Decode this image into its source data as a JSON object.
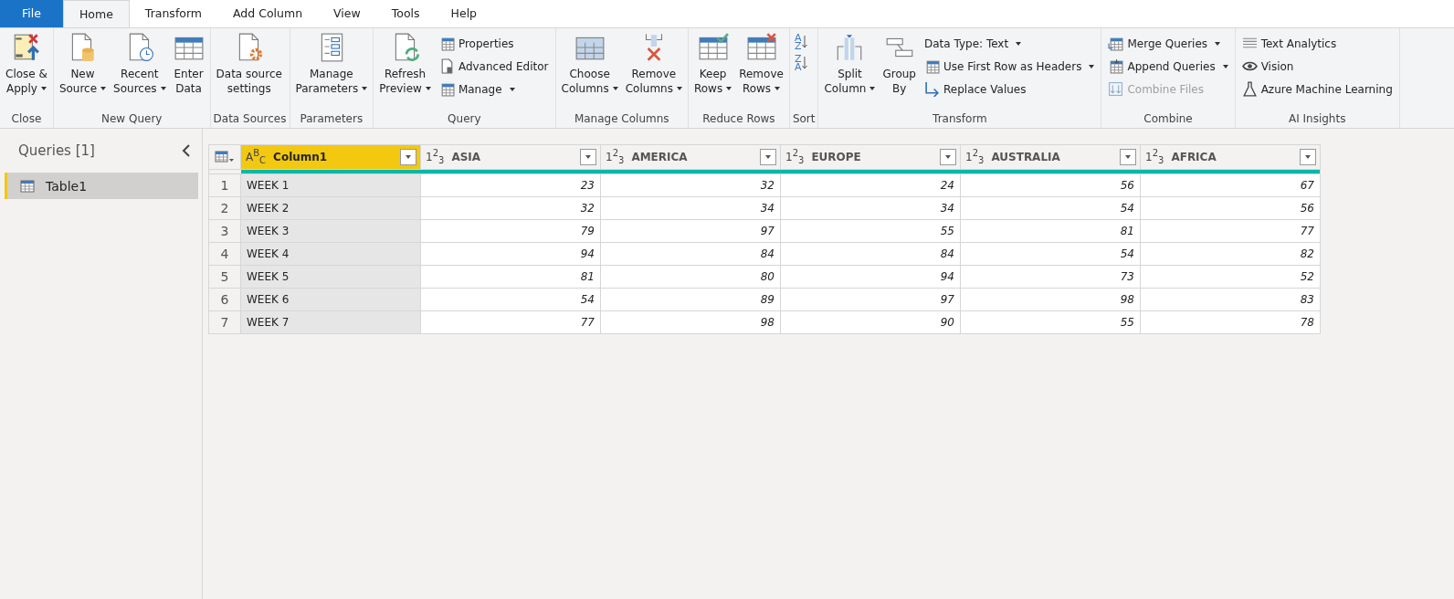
{
  "tabs": [
    {
      "label": "File",
      "kind": "file",
      "selected": false
    },
    {
      "label": "Home",
      "kind": "tab",
      "selected": true
    },
    {
      "label": "Transform",
      "kind": "tab",
      "selected": false
    },
    {
      "label": "Add Column",
      "kind": "tab",
      "selected": false
    },
    {
      "label": "View",
      "kind": "tab",
      "selected": false
    },
    {
      "label": "Tools",
      "kind": "tab",
      "selected": false
    },
    {
      "label": "Help",
      "kind": "tab",
      "selected": false
    }
  ],
  "ribbon": [
    {
      "label": "Close",
      "items": [
        {
          "kind": "large",
          "lines": [
            "Close &",
            "Apply"
          ],
          "dropdown": true
        }
      ]
    },
    {
      "label": "New Query",
      "items": [
        {
          "kind": "large",
          "lines": [
            "New",
            "Source"
          ],
          "dropdown": true
        },
        {
          "kind": "large",
          "lines": [
            "Recent",
            "Sources"
          ],
          "dropdown": true
        },
        {
          "kind": "large",
          "lines": [
            "Enter",
            "Data"
          ],
          "dropdown": false
        }
      ]
    },
    {
      "label": "Data Sources",
      "items": [
        {
          "kind": "large",
          "lines": [
            "Data source",
            "settings"
          ],
          "dropdown": false
        }
      ]
    },
    {
      "label": "Parameters",
      "items": [
        {
          "kind": "large",
          "lines": [
            "Manage",
            "Parameters"
          ],
          "dropdown": true
        }
      ]
    },
    {
      "label": "Query",
      "items": [
        {
          "kind": "large",
          "lines": [
            "Refresh",
            "Preview"
          ],
          "dropdown": true
        },
        {
          "kind": "stack",
          "children": [
            {
              "label": "Properties",
              "dropdown": false,
              "disabled": false
            },
            {
              "label": "Advanced Editor",
              "dropdown": false,
              "disabled": false
            },
            {
              "label": "Manage",
              "dropdown": true,
              "disabled": false
            }
          ]
        }
      ]
    },
    {
      "label": "Manage Columns",
      "items": [
        {
          "kind": "large",
          "lines": [
            "Choose",
            "Columns"
          ],
          "dropdown": true
        },
        {
          "kind": "large",
          "lines": [
            "Remove",
            "Columns"
          ],
          "dropdown": true
        }
      ]
    },
    {
      "label": "Reduce Rows",
      "items": [
        {
          "kind": "large",
          "lines": [
            "Keep",
            "Rows"
          ],
          "dropdown": true
        },
        {
          "kind": "large",
          "lines": [
            "Remove",
            "Rows"
          ],
          "dropdown": true
        }
      ]
    },
    {
      "label": "Sort",
      "items": [
        {
          "kind": "sort",
          "children": [
            {
              "glyph": "AZ"
            },
            {
              "glyph": "ZA"
            }
          ]
        }
      ]
    },
    {
      "label": "Transform",
      "items": [
        {
          "kind": "large",
          "lines": [
            "Split",
            "Column"
          ],
          "dropdown": true
        },
        {
          "kind": "large",
          "lines": [
            "Group",
            "By"
          ],
          "dropdown": false
        },
        {
          "kind": "stack",
          "children": [
            {
              "label": "Data Type: Text",
              "dropdown": true,
              "disabled": false
            },
            {
              "label": "Use First Row as Headers",
              "dropdown": true,
              "disabled": false
            },
            {
              "label": "Replace Values",
              "dropdown": false,
              "disabled": false
            }
          ]
        }
      ]
    },
    {
      "label": "Combine",
      "items": [
        {
          "kind": "stack",
          "children": [
            {
              "label": "Merge Queries",
              "dropdown": true,
              "disabled": false
            },
            {
              "label": "Append Queries",
              "dropdown": true,
              "disabled": false
            },
            {
              "label": "Combine Files",
              "dropdown": false,
              "disabled": true
            }
          ]
        }
      ]
    },
    {
      "label": "AI Insights",
      "items": [
        {
          "kind": "stack",
          "children": [
            {
              "label": "Text Analytics",
              "dropdown": false,
              "disabled": false
            },
            {
              "label": "Vision",
              "dropdown": false,
              "disabled": false
            },
            {
              "label": "Azure Machine Learning",
              "dropdown": false,
              "disabled": false
            }
          ]
        }
      ]
    }
  ],
  "sidebar": {
    "title": "Queries [1]",
    "items": [
      {
        "label": "Table1",
        "selected": true
      }
    ]
  },
  "table": {
    "columns": [
      {
        "type_glyph": "A$^{B}$$_{C}$",
        "name": "Column1",
        "kind": "text",
        "selected": true
      },
      {
        "type_glyph": "1$^{2}$$_{3}$",
        "name": "ASIA",
        "kind": "number",
        "selected": false
      },
      {
        "type_glyph": "1$^{2}$$_{3}$",
        "name": "AMERICA",
        "kind": "number",
        "selected": false
      },
      {
        "type_glyph": "1$^{2}$$_{3}$",
        "name": "EUROPE",
        "kind": "number",
        "selected": false
      },
      {
        "type_glyph": "1$^{2}$$_{3}$",
        "name": "AUSTRALIA",
        "kind": "number",
        "selected": false
      },
      {
        "type_glyph": "1$^{2}$$_{3}$",
        "name": "AFRICA",
        "kind": "number",
        "selected": false
      }
    ],
    "rows": [
      {
        "number": "1",
        "cells": [
          "WEEK 1",
          "23",
          "32",
          "24",
          "56",
          "67"
        ]
      },
      {
        "number": "2",
        "cells": [
          "WEEK 2",
          "32",
          "34",
          "34",
          "54",
          "56"
        ]
      },
      {
        "number": "3",
        "cells": [
          "WEEK 3",
          "79",
          "97",
          "55",
          "81",
          "77"
        ]
      },
      {
        "number": "4",
        "cells": [
          "WEEK 4",
          "94",
          "84",
          "84",
          "54",
          "82"
        ]
      },
      {
        "number": "5",
        "cells": [
          "WEEK 5",
          "81",
          "80",
          "94",
          "73",
          "52"
        ]
      },
      {
        "number": "6",
        "cells": [
          "WEEK 6",
          "54",
          "89",
          "97",
          "98",
          "83"
        ]
      },
      {
        "number": "7",
        "cells": [
          "WEEK 7",
          "77",
          "98",
          "90",
          "55",
          "78"
        ]
      }
    ]
  }
}
